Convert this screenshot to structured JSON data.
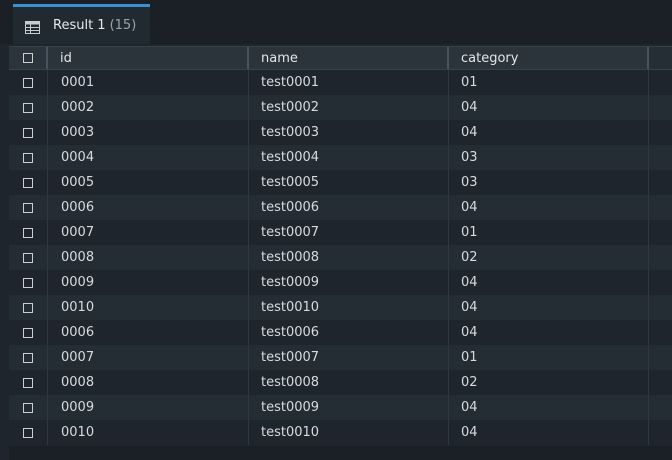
{
  "tab": {
    "label": "Result 1",
    "count": "(15)",
    "icon": "table-grid-icon",
    "accent": "#3b8fd4"
  },
  "columns": [
    "id",
    "name",
    "category"
  ],
  "rows": [
    {
      "id": "0001",
      "name": "test0001",
      "category": "01"
    },
    {
      "id": "0002",
      "name": "test0002",
      "category": "04"
    },
    {
      "id": "0003",
      "name": "test0003",
      "category": "04"
    },
    {
      "id": "0004",
      "name": "test0004",
      "category": "03"
    },
    {
      "id": "0005",
      "name": "test0005",
      "category": "03"
    },
    {
      "id": "0006",
      "name": "test0006",
      "category": "04"
    },
    {
      "id": "0007",
      "name": "test0007",
      "category": "01"
    },
    {
      "id": "0008",
      "name": "test0008",
      "category": "02"
    },
    {
      "id": "0009",
      "name": "test0009",
      "category": "04"
    },
    {
      "id": "0010",
      "name": "test0010",
      "category": "04"
    },
    {
      "id": "0006",
      "name": "test0006",
      "category": "04"
    },
    {
      "id": "0007",
      "name": "test0007",
      "category": "01"
    },
    {
      "id": "0008",
      "name": "test0008",
      "category": "02"
    },
    {
      "id": "0009",
      "name": "test0009",
      "category": "04"
    },
    {
      "id": "0010",
      "name": "test0010",
      "category": "04"
    }
  ]
}
